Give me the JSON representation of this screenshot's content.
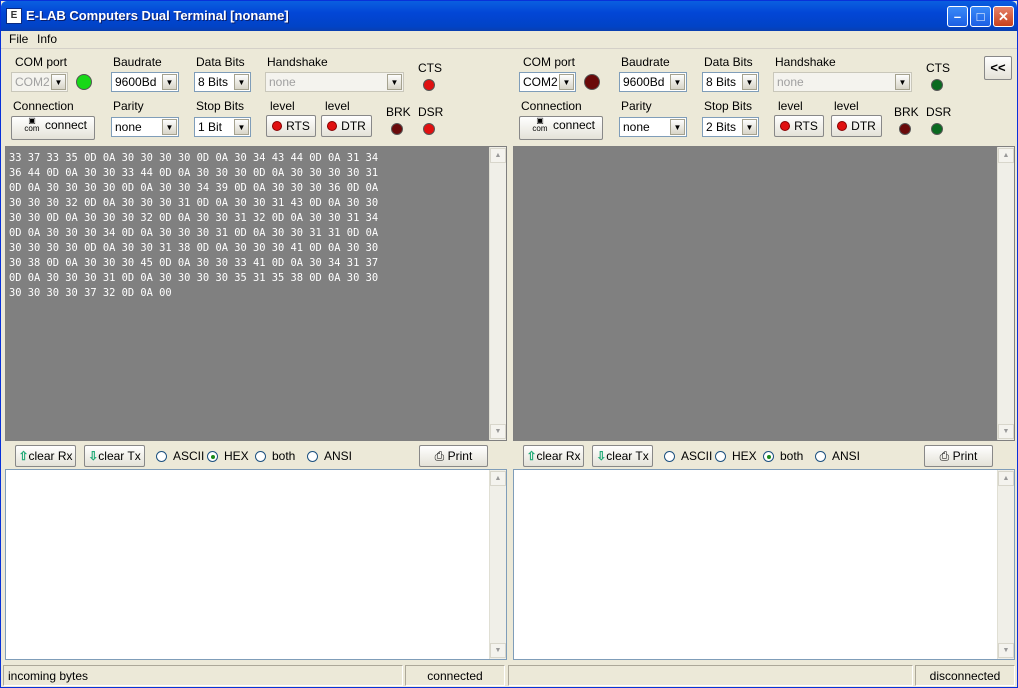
{
  "window": {
    "title": "E-LAB Computers Dual Terminal [noname]",
    "app_icon": "elab-icon"
  },
  "menu": [
    "File",
    "Info"
  ],
  "labels": {
    "com_port": "COM port",
    "baudrate": "Baudrate",
    "data_bits": "Data Bits",
    "handshake": "Handshake",
    "cts": "CTS",
    "connection": "Connection",
    "parity": "Parity",
    "stop_bits": "Stop Bits",
    "level": "level",
    "brk": "BRK",
    "dsr": "DSR"
  },
  "buttons": {
    "connect": "connect",
    "com": "com",
    "rts": "RTS",
    "dtr": "DTR",
    "clear_rx": "clear Rx",
    "clear_tx": "clear Tx",
    "print": "Print",
    "collapse": "<<"
  },
  "radio_labels": {
    "ascii": "ASCII",
    "hex": "HEX",
    "both": "both",
    "ansi": "ANSI"
  },
  "left": {
    "com_port": "COM2",
    "baudrate": "9600Bd",
    "data_bits": "8 Bits",
    "handshake": "none",
    "parity": "none",
    "stop_bits": "1 Bit",
    "display_mode": "HEX",
    "leds": {
      "port": "#18d818",
      "cts": "#e01010",
      "brk": "#6a0a0a",
      "dsr": "#e01010"
    },
    "rx_lines": [
      "33 37 33 35 0D 0A 30 30 30 30 0D 0A 30 34 43 44 0D 0A 31 34",
      "36 44 0D 0A 30 30 33 44 0D 0A 30 30 30 0D 0A 30 30 30 30 31",
      "0D 0A 30 30 30 30 0D 0A 30 30 34 39 0D 0A 30 30 30 36 0D 0A",
      "30 30 30 32 0D 0A 30 30 30 31 0D 0A 30 30 31 43 0D 0A 30 30",
      "30 30 0D 0A 30 30 30 32 0D 0A 30 30 31 32 0D 0A 30 30 31 34",
      "0D 0A 30 30 30 34 0D 0A 30 30 30 31 0D 0A 30 30 31 31 0D 0A",
      "30 30 30 30 0D 0A 30 30 31 38 0D 0A 30 30 30 41 0D 0A 30 30",
      "30 38 0D 0A 30 30 30 45 0D 0A 30 30 33 41 0D 0A 30 34 31 37",
      "0D 0A 30 30 30 31 0D 0A 30 30 30 30 35 31 35 38 0D 0A 30 30",
      "30 30 30 30 37 32 0D 0A 00"
    ],
    "status_left": "incoming bytes",
    "status_right": "connected"
  },
  "right": {
    "com_port": "COM2",
    "baudrate": "9600Bd",
    "data_bits": "8 Bits",
    "handshake": "none",
    "parity": "none",
    "stop_bits": "2 Bits",
    "display_mode": "both",
    "leds": {
      "port": "#6a0a0a",
      "cts": "#0a6a20",
      "brk": "#6a0a0a",
      "dsr": "#0a6a20"
    },
    "rx_lines": [],
    "status_left": "",
    "status_right": "disconnected"
  }
}
